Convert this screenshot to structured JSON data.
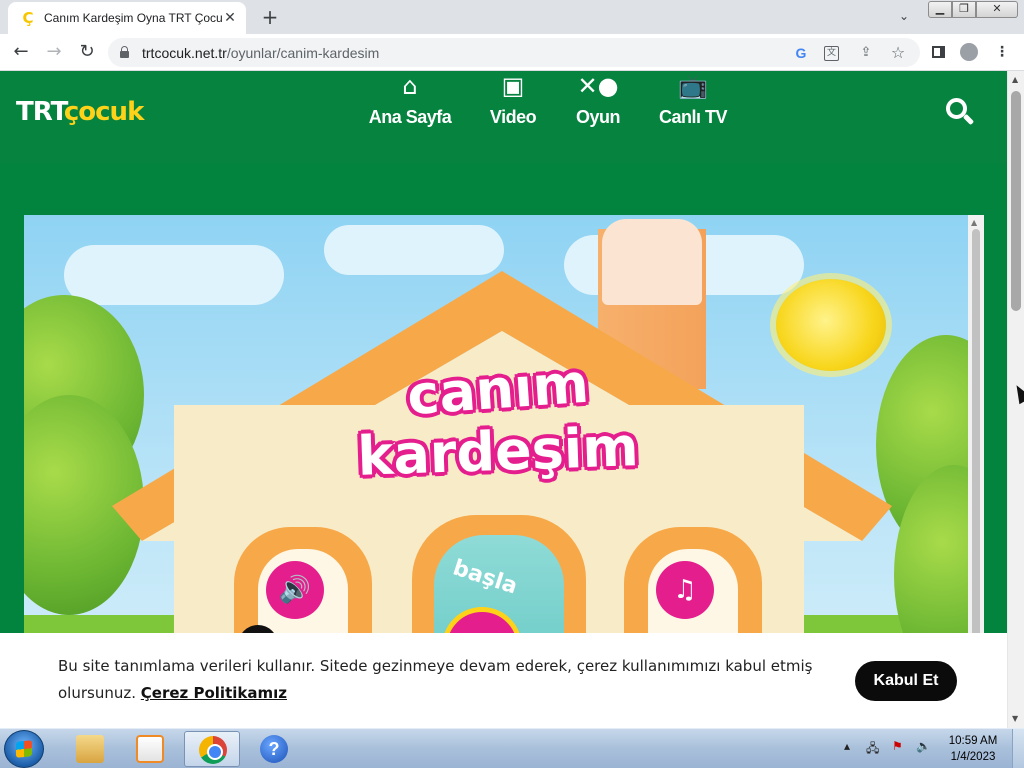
{
  "browser": {
    "tab": {
      "title": "Canım Kardeşim Oyna TRT Çocuk",
      "favicon": "trt-cocuk-c-icon",
      "close": "✕"
    },
    "new_tab": "+",
    "window_controls": {
      "minimize": "▁",
      "maximize": "❐",
      "close": "✕"
    },
    "url_host": "trtcocuk.net.tr",
    "url_path": "/oyunlar/canim-kardesim",
    "icons": [
      "back-icon",
      "forward-icon",
      "reload-icon",
      "lock-icon",
      "google-icon",
      "translate-icon",
      "share-icon",
      "star-icon",
      "side-panel-icon",
      "profile-icon",
      "menu-icon"
    ]
  },
  "site": {
    "logo": {
      "trt": "TRT",
      "cocuk": "çocuk"
    },
    "nav": [
      {
        "label": "Ana Sayfa",
        "icon": "home-icon"
      },
      {
        "label": "Video",
        "icon": "video-icon"
      },
      {
        "label": "Oyun",
        "icon": "game-icon"
      },
      {
        "label": "Canlı TV",
        "icon": "tv-icon"
      }
    ],
    "search_icon": "search-icon",
    "colors": {
      "header_green": "#05833f",
      "logo_yellow": "#ffd21a",
      "accent_pink": "#e51e8e"
    }
  },
  "game": {
    "title_line1": "canım",
    "title_line2": "kardeşim",
    "start_label": "başla",
    "buttons": [
      "sound-icon",
      "start-button",
      "music-icon"
    ]
  },
  "cookie": {
    "text": "Bu site tanımlama verileri kullanır. Sitede gezinmeye devam ederek, çerez kullanımımızı kabul etmiş olursunuz.",
    "link": "Çerez Politikamız",
    "accept": "Kabul Et"
  },
  "taskbar": {
    "time": "10:59 AM",
    "date": "1/4/2023"
  }
}
